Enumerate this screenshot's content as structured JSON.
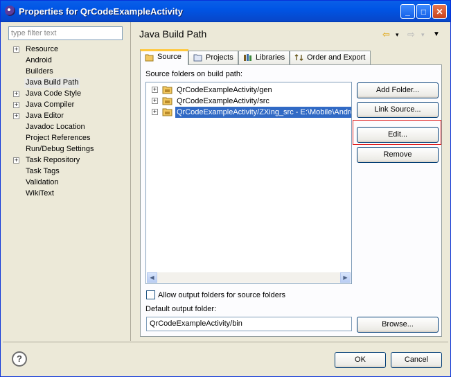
{
  "window": {
    "title": "Properties for QrCodeExampleActivity",
    "minimize": "_",
    "maximize": "□",
    "close": "✕"
  },
  "filter": {
    "placeholder": "type filter text"
  },
  "tree": [
    {
      "label": "Resource",
      "expandable": true
    },
    {
      "label": "Android",
      "expandable": false
    },
    {
      "label": "Builders",
      "expandable": false
    },
    {
      "label": "Java Build Path",
      "expandable": false,
      "selected": true
    },
    {
      "label": "Java Code Style",
      "expandable": true
    },
    {
      "label": "Java Compiler",
      "expandable": true
    },
    {
      "label": "Java Editor",
      "expandable": true
    },
    {
      "label": "Javadoc Location",
      "expandable": false
    },
    {
      "label": "Project References",
      "expandable": false
    },
    {
      "label": "Run/Debug Settings",
      "expandable": false
    },
    {
      "label": "Task Repository",
      "expandable": true
    },
    {
      "label": "Task Tags",
      "expandable": false
    },
    {
      "label": "Validation",
      "expandable": false
    },
    {
      "label": "WikiText",
      "expandable": false
    }
  ],
  "panel": {
    "title": "Java Build Path",
    "back_icon": "⇦",
    "forward_icon": "⇨",
    "menu_icon": "▼",
    "dropdown_icon": "▾"
  },
  "tabs": [
    {
      "label": "Source",
      "active": true,
      "icon": "folder-icon"
    },
    {
      "label": "Projects",
      "icon": "project-icon"
    },
    {
      "label": "Libraries",
      "icon": "library-icon"
    },
    {
      "label": "Order and Export",
      "icon": "order-icon"
    }
  ],
  "source": {
    "list_label": "Source folders on build path:",
    "folders": [
      {
        "label": "QrCodeExampleActivity/gen"
      },
      {
        "label": "QrCodeExampleActivity/src"
      },
      {
        "label": "QrCodeExampleActivity/ZXing_src - E:\\Mobile\\Android",
        "selected": true
      }
    ],
    "buttons": {
      "add_folder": "Add Folder...",
      "link_source": "Link Source...",
      "edit": "Edit...",
      "remove": "Remove",
      "browse": "Browse..."
    },
    "allow_output_label": "Allow output folders for source folders",
    "default_output_label": "Default output folder:",
    "default_output_value": "QrCodeExampleActivity/bin"
  },
  "footer": {
    "help": "?",
    "ok": "OK",
    "cancel": "Cancel"
  },
  "colors": {
    "titlebar": "#0055e5",
    "selection": "#316ac5",
    "highlight_box": "#e02020",
    "active_tab": "#ffc83c"
  }
}
